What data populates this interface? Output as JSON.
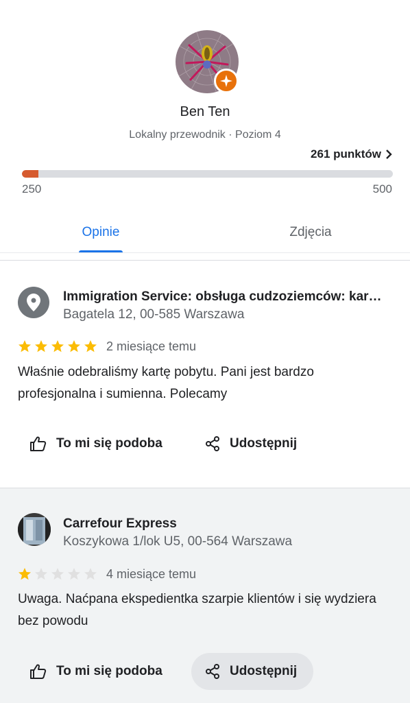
{
  "profile": {
    "name": "Ben Ten",
    "level_text": "Lokalny przewodnik · Poziom 4",
    "points_label": "261 punktów",
    "points": 261,
    "progress_min": "250",
    "progress_max": "500",
    "progress_fraction": 0.044,
    "accent_color": "#d65b2f"
  },
  "tabs": [
    {
      "label": "Opinie",
      "active": true
    },
    {
      "label": "Zdjęcia",
      "active": false
    }
  ],
  "reviews": [
    {
      "place_name": "Immigration Service: obsługa cudzoziemców: kar…",
      "address": "Bagatela 12, 00-585 Warszawa",
      "rating": 5,
      "when": "2 miesiące temu",
      "text": "Właśnie odebraliśmy kartę pobytu. Pani jest bardzo profesjonalna i sumienna. Polecamy",
      "like_label": "To mi się podoba",
      "share_label": "Udostępnij"
    },
    {
      "place_name": "Carrefour Express",
      "address": "Koszykowa 1/lok U5, 00-564 Warszawa",
      "rating": 1,
      "when": "4 miesiące temu",
      "text": "Uwaga. Naćpana ekspedientka szarpie klientów i się wydziera bez powodu",
      "like_label": "To mi się podoba",
      "share_label": "Udostępnij"
    }
  ],
  "colors": {
    "star_filled": "#fbbc04",
    "star_empty": "#e0e0e0",
    "tab_active": "#1a73e8"
  }
}
